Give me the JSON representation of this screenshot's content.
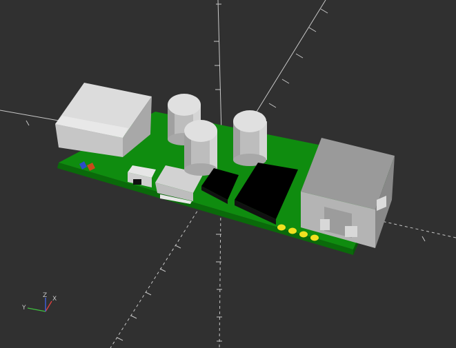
{
  "viewport": {
    "background": "#303030",
    "axis_color": "#c8c8c8"
  },
  "model": {
    "pcb_color": "#0f8c0f",
    "component_gray": "#c8c8c8",
    "ic_color": "#000000",
    "pad_color": "#f0e020",
    "led_colors": [
      "#2a4cc8",
      "#c84a1a"
    ]
  },
  "axes_gizmo": {
    "x_label": "X",
    "y_label": "Y",
    "z_label": "Z",
    "x_color": "#e04040",
    "y_color": "#40c040",
    "z_color": "#4060e0"
  }
}
